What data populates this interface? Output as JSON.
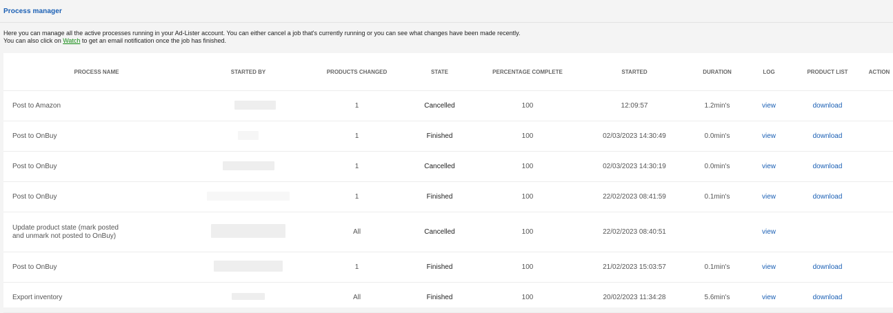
{
  "header": {
    "title": "Process manager"
  },
  "intro": {
    "line1": "Here you can manage all the active processes running in your Ad-Lister account. You can either cancel a job that's currently running or you can see what changes have been made recently.",
    "line2_before": "You can also click on ",
    "line2_link": "Watch",
    "line2_after": " to get an email notification once the job has finished."
  },
  "table": {
    "columns": [
      "PROCESS NAME",
      "STARTED BY",
      "PRODUCTS CHANGED",
      "STATE",
      "PERCENTAGE COMPLETE",
      "STARTED",
      "DURATION",
      "LOG",
      "PRODUCT LIST",
      "ACTION"
    ],
    "rows": [
      {
        "name": "Post to Amazon",
        "changed": "1",
        "state": "Cancelled",
        "percent": "100",
        "started": "12:09:57",
        "duration": "1.2min's",
        "log": "view",
        "list": "download"
      },
      {
        "name": "Post to OnBuy",
        "changed": "1",
        "state": "Finished",
        "percent": "100",
        "started": "02/03/2023 14:30:49",
        "duration": "0.0min's",
        "log": "view",
        "list": "download"
      },
      {
        "name": "Post to OnBuy",
        "changed": "1",
        "state": "Cancelled",
        "percent": "100",
        "started": "02/03/2023 14:30:19",
        "duration": "0.0min's",
        "log": "view",
        "list": "download"
      },
      {
        "name": "Post to OnBuy",
        "changed": "1",
        "state": "Finished",
        "percent": "100",
        "started": "22/02/2023 08:41:59",
        "duration": "0.1min's",
        "log": "view",
        "list": "download"
      },
      {
        "name_line1": "Update product state (mark posted",
        "name_line2": "and unmark not posted to OnBuy)",
        "changed": "All",
        "state": "Cancelled",
        "percent": "100",
        "started": "22/02/2023 08:40:51",
        "duration": "",
        "log": "view",
        "list": ""
      },
      {
        "name": "Post to OnBuy",
        "changed": "1",
        "state": "Finished",
        "percent": "100",
        "started": "21/02/2023 15:03:57",
        "duration": "0.1min's",
        "log": "view",
        "list": "download"
      },
      {
        "name": "Export inventory",
        "changed": "All",
        "state": "Finished",
        "percent": "100",
        "started": "20/02/2023 11:34:28",
        "duration": "5.6min's",
        "log": "view",
        "list": "download"
      }
    ]
  }
}
